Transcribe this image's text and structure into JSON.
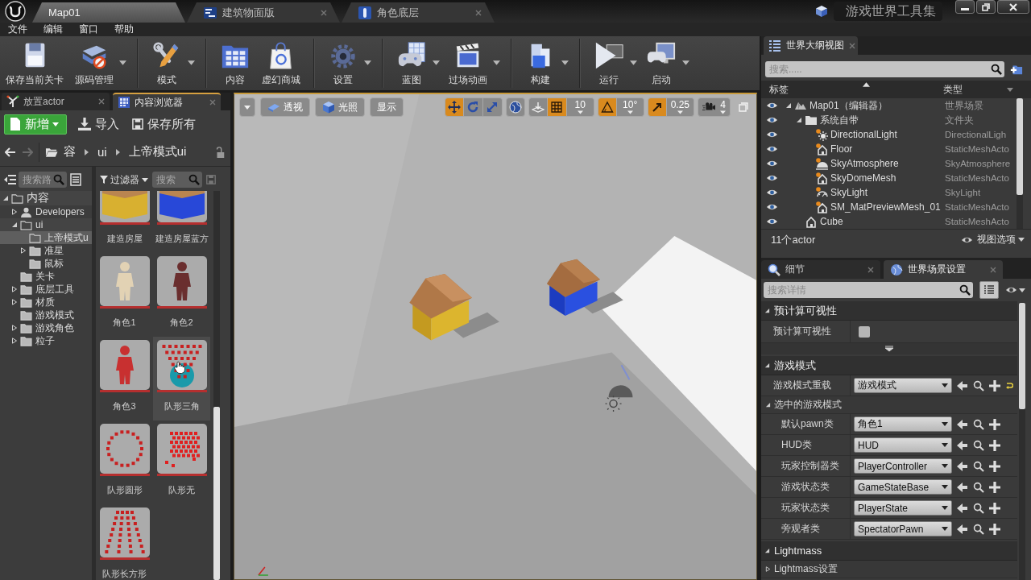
{
  "title_bar": {
    "tabs": [
      {
        "label": "Map01",
        "selected": true,
        "kind": "level"
      },
      {
        "label": "建筑物面版",
        "selected": false,
        "kind": "widget"
      },
      {
        "label": "角色底层",
        "selected": false,
        "kind": "character"
      }
    ],
    "project": "游戏世界工具集"
  },
  "menu_bar": {
    "items": [
      "文件",
      "编辑",
      "窗口",
      "帮助"
    ]
  },
  "toolbar": {
    "groups": [
      {
        "items": [
          {
            "label": "保存当前关卡",
            "kind": "save",
            "dropdown": false
          },
          {
            "label": "源码管理",
            "kind": "source",
            "dropdown": true
          }
        ]
      },
      {
        "items": [
          {
            "label": "模式",
            "kind": "modes",
            "dropdown": true
          }
        ]
      },
      {
        "items": [
          {
            "label": "内容",
            "kind": "content",
            "dropdown": false
          },
          {
            "label": "虚幻商城",
            "kind": "market",
            "dropdown": false
          }
        ]
      },
      {
        "items": [
          {
            "label": "设置",
            "kind": "settings",
            "dropdown": true
          }
        ]
      },
      {
        "items": [
          {
            "label": "蓝图",
            "kind": "blueprint",
            "dropdown": true
          },
          {
            "label": "过场动画",
            "kind": "cinematics",
            "dropdown": true
          }
        ]
      },
      {
        "items": [
          {
            "label": "构建",
            "kind": "build",
            "dropdown": true
          }
        ]
      },
      {
        "items": [
          {
            "label": "运行",
            "kind": "play",
            "dropdown": true
          },
          {
            "label": "启动",
            "kind": "launch",
            "dropdown": true
          }
        ]
      }
    ]
  },
  "content_panel": {
    "tabs": [
      {
        "label": "放置actor",
        "selected": false,
        "kind": "place"
      },
      {
        "label": "内容浏览器",
        "selected": true,
        "kind": "browser"
      }
    ],
    "new_button": "新增",
    "import_button": "导入",
    "save_all_button": "保存所有",
    "back": {
      "disabled": false
    },
    "forward": {
      "disabled": true
    },
    "breadcrumb": [
      "容",
      "ui",
      "上帝模式ui"
    ],
    "tree_search": {
      "placeholder": "搜索路"
    },
    "tree": [
      {
        "label": "内容",
        "kind": "folder",
        "expanded": true,
        "selected": false,
        "children": [
          {
            "label": "Developers",
            "kind": "user",
            "expanded": false,
            "selected": false
          },
          {
            "label": "ui",
            "kind": "folder",
            "expanded": true,
            "selected": false,
            "children": [
              {
                "label": "上帝模式u",
                "kind": "folder",
                "selected": true
              },
              {
                "label": "准星",
                "kind": "folder",
                "expanded": false,
                "selected": false
              },
              {
                "label": "鼠标",
                "kind": "folder",
                "selected": false
              }
            ]
          },
          {
            "label": "关卡",
            "kind": "folder",
            "selected": false
          },
          {
            "label": "底层工具",
            "kind": "folder",
            "expanded": false,
            "selected": false
          },
          {
            "label": "材质",
            "kind": "folder",
            "expanded": false,
            "selected": false
          },
          {
            "label": "游戏模式",
            "kind": "folder",
            "selected": false
          },
          {
            "label": "游戏角色",
            "kind": "folder",
            "expanded": false,
            "selected": false
          },
          {
            "label": "粒子",
            "kind": "folder",
            "expanded": false,
            "selected": false
          }
        ]
      }
    ],
    "asset_filter": "过滤器",
    "asset_search": {
      "placeholder": "搜索"
    },
    "assets": [
      {
        "label": "建造房屋",
        "kind": "house",
        "color": "#d8b030",
        "hovered": false
      },
      {
        "label": "建造房屋蓝方",
        "kind": "house",
        "color": "#2848d8",
        "hovered": false
      },
      {
        "label": "角色1",
        "kind": "figure",
        "color": "#e2d2b4",
        "hovered": false
      },
      {
        "label": "角色2",
        "kind": "figure",
        "color": "#6a2e2e",
        "hovered": false
      },
      {
        "label": "角色3",
        "kind": "figure",
        "color": "#c83030",
        "hovered": false
      },
      {
        "label": "队形三角",
        "kind": "wedge",
        "color": "#c82020",
        "hovered": true
      },
      {
        "label": "队形圆形",
        "kind": "ring",
        "color": "#c82020",
        "hovered": false
      },
      {
        "label": "队形无",
        "kind": "cluster",
        "color": "#e02020",
        "hovered": false
      },
      {
        "label": "队形长方形",
        "kind": "columns",
        "color": "#c82020",
        "hovered": false
      }
    ]
  },
  "viewport": {
    "toolbar": {
      "view_mode": "透视",
      "lighting": "光照",
      "show": "显示",
      "tools": [
        {
          "kind": "move",
          "selected": true
        },
        {
          "kind": "rotate",
          "selected": false
        },
        {
          "kind": "scale",
          "selected": false
        }
      ],
      "snaps": [
        {
          "kind": "grid",
          "on": true,
          "value": "10"
        },
        {
          "kind": "angle",
          "on": true,
          "value": "10°"
        },
        {
          "kind": "scale",
          "on": true,
          "value": "0.25"
        }
      ],
      "camera_speed": "4"
    }
  },
  "outliner": {
    "title": "世界大纲视图",
    "search": {
      "placeholder": "搜索....."
    },
    "columns": [
      "标签",
      "类型"
    ],
    "rows": [
      {
        "label": "Map01（编辑器）",
        "type": "世界场景",
        "kind": "world",
        "visible": true,
        "expanded": true,
        "children": [
          {
            "label": "系统自带",
            "type": "文件夹",
            "kind": "folder",
            "visible": true,
            "expanded": true,
            "children": [
              {
                "label": "DirectionalLight",
                "type": "DirectionalLigh",
                "kind": "sun",
                "visible": true
              },
              {
                "label": "Floor",
                "type": "StaticMeshActo",
                "kind": "mesh",
                "visible": true
              },
              {
                "label": "SkyAtmosphere",
                "type": "SkyAtmosphere",
                "kind": "atmosphere",
                "visible": true
              },
              {
                "label": "SkyDomeMesh",
                "type": "StaticMeshActo",
                "kind": "mesh",
                "visible": true
              },
              {
                "label": "SkyLight",
                "type": "SkyLight",
                "kind": "skylight",
                "visible": true
              },
              {
                "label": "SM_MatPreviewMesh_01",
                "type": "StaticMeshActo",
                "kind": "mesh",
                "visible": true
              }
            ]
          },
          {
            "label": "Cube",
            "type": "StaticMeshActo",
            "kind": "actor",
            "visible": true
          }
        ]
      }
    ],
    "count": "11个actor",
    "view_options": "视图选项"
  },
  "details": {
    "tabs": [
      {
        "label": "细节",
        "selected": false,
        "kind": "details"
      },
      {
        "label": "世界场景设置",
        "selected": true,
        "kind": "world"
      }
    ],
    "search": {
      "placeholder": "搜索详情"
    },
    "categories": [
      {
        "title": "预计算可视性",
        "expanded": true,
        "advanced": true,
        "rows": [
          {
            "kind": "checkbox",
            "label": "预计算可视性",
            "checked": false
          }
        ]
      },
      {
        "title": "游戏模式",
        "expanded": true,
        "rows": [
          {
            "kind": "class",
            "label": "游戏模式重载",
            "value": "游戏模式",
            "modified": true
          },
          {
            "kind": "group",
            "label": "选中的游戏模式",
            "expanded": true,
            "rows": [
              {
                "kind": "class",
                "label": "默认pawn类",
                "value": "角色1",
                "modified": false
              },
              {
                "kind": "class",
                "label": "HUD类",
                "value": "HUD",
                "modified": false
              },
              {
                "kind": "class",
                "label": "玩家控制器类",
                "value": "PlayerController",
                "modified": false
              },
              {
                "kind": "class",
                "label": "游戏状态类",
                "value": "GameStateBase",
                "modified": false
              },
              {
                "kind": "class",
                "label": "玩家状态类",
                "value": "PlayerState",
                "modified": false
              },
              {
                "kind": "class",
                "label": "旁观者类",
                "value": "SpectatorPawn",
                "modified": false
              }
            ]
          }
        ]
      },
      {
        "title": "Lightmass",
        "expanded": true,
        "rows": [
          {
            "kind": "group",
            "label": "Lightmass设置",
            "expanded": false
          }
        ]
      }
    ]
  }
}
